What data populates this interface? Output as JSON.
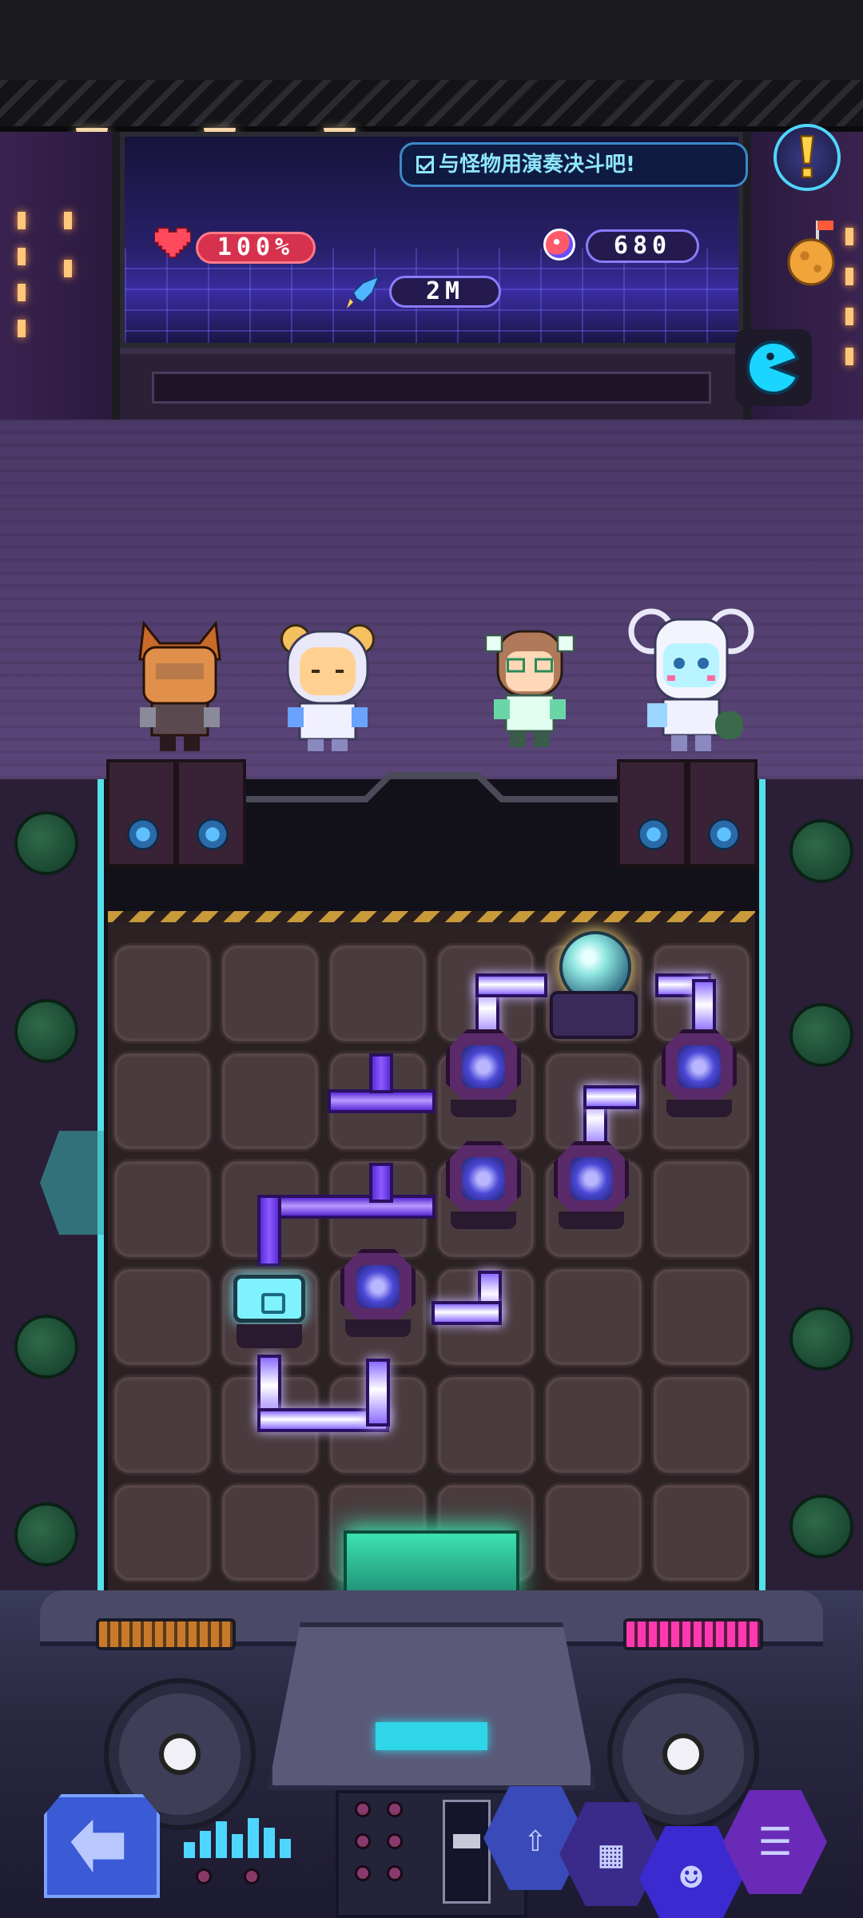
{
  "hud": {
    "mission_text": "与怪物用演奏决斗吧!",
    "health": "100%",
    "coins": "680",
    "distance": "2M"
  },
  "icons": {
    "mission": "checkbox-icon",
    "health": "heart-icon",
    "coins": "gem-coin-icon",
    "distance": "rocket-icon",
    "alert": "exclamation-icon",
    "planet": "planet-flag-icon",
    "pac": "pacman-icon",
    "back": "back-arrow-icon",
    "upgrade": "upgrade-arrows-icon",
    "inventory": "backpack-icon",
    "team": "team-icon",
    "menu": "list-menu-icon"
  },
  "colors": {
    "health_pill": "#d6324e",
    "pill_border": "#8b7cff",
    "mission_text": "#8fe7ff",
    "pipe": "#8a5cff",
    "lit_pipe": "#ffffff",
    "exit_pad": "#3ce2b0",
    "side_trim": "#54e0e8"
  }
}
